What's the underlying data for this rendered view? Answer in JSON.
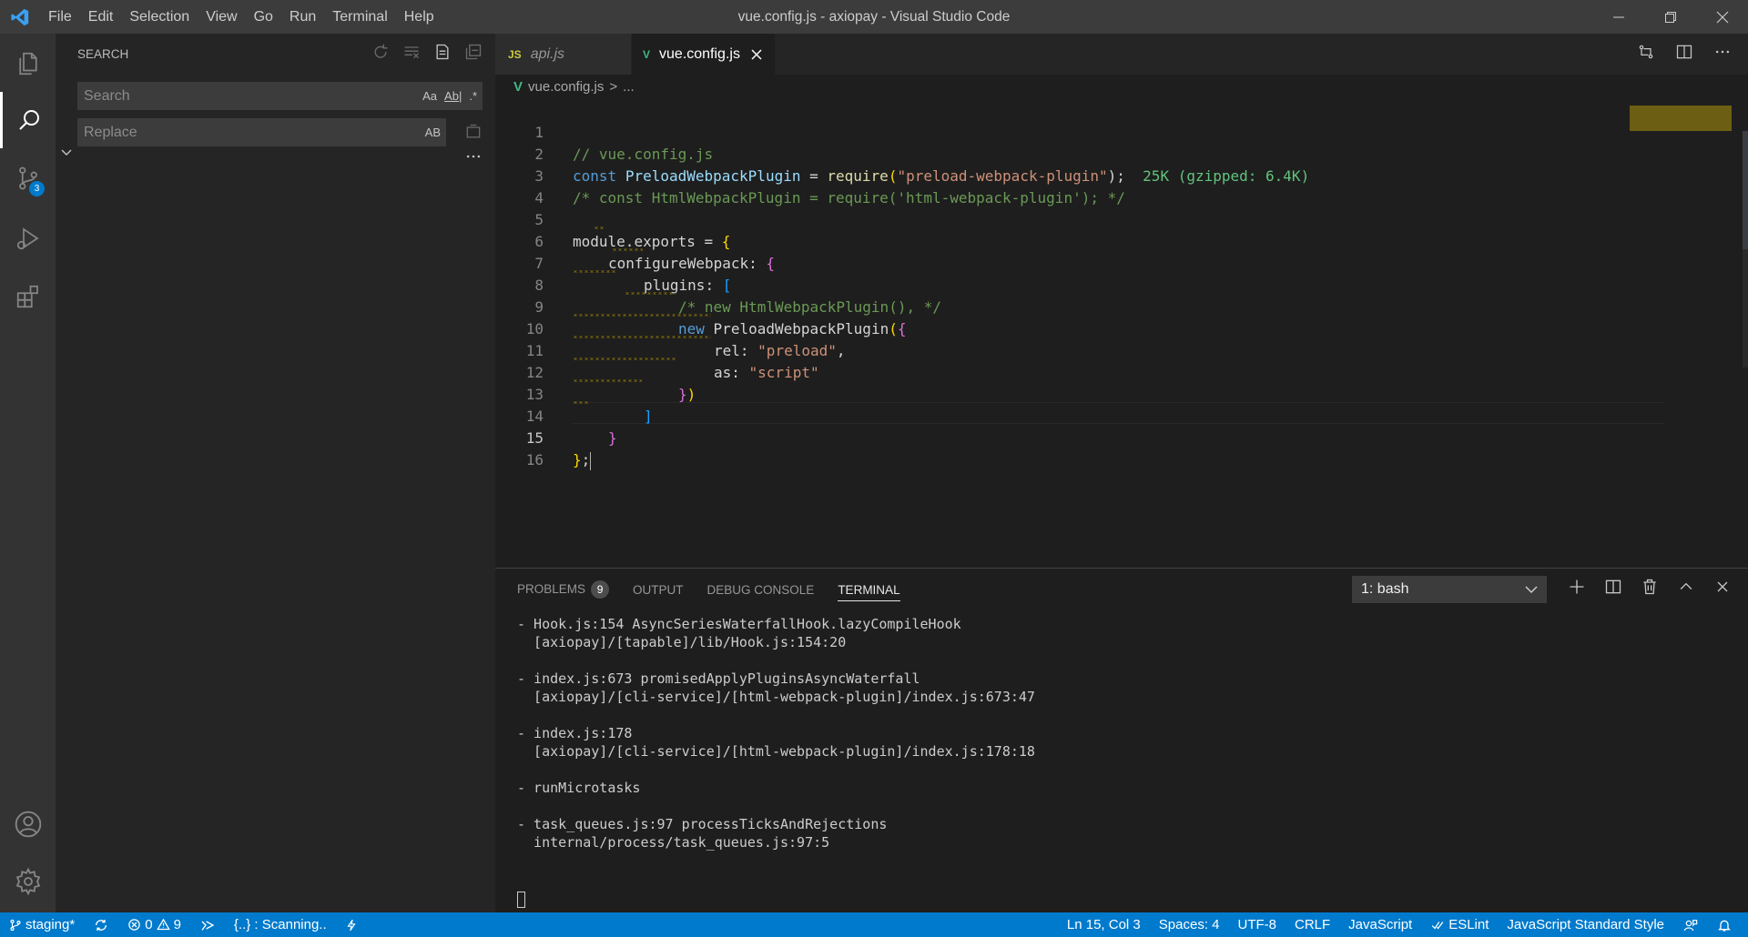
{
  "window": {
    "title": "vue.config.js - axiopay - Visual Studio Code",
    "menu": [
      "File",
      "Edit",
      "Selection",
      "View",
      "Go",
      "Run",
      "Terminal",
      "Help"
    ]
  },
  "activity": {
    "scm_badge": "3"
  },
  "sidebar": {
    "title": "SEARCH",
    "search_placeholder": "Search",
    "replace_placeholder": "Replace",
    "opt_case": "Aa",
    "opt_word": "Ab|",
    "opt_regex": ".*",
    "opt_preserve": "AB"
  },
  "tabs": [
    {
      "icon": "JS",
      "label": "api.js"
    },
    {
      "icon": "V",
      "label": "vue.config.js"
    }
  ],
  "breadcrumb": {
    "file": "vue.config.js",
    "sep": ">",
    "rest": "..."
  },
  "editor": {
    "line_numbers": [
      "1",
      "2",
      "3",
      "4",
      "5",
      "6",
      "7",
      "8",
      "9",
      "10",
      "11",
      "12",
      "13",
      "14",
      "15",
      "16"
    ],
    "lines": {
      "l1": "// vue.config.js",
      "l2_kw": "const",
      "l2_var": "PreloadWebpackPlugin",
      "l2_eq": " = ",
      "l2_fn": "require",
      "l2_open": "(",
      "l2_str": "\"preload-webpack-plugin\"",
      "l2_close": ");",
      "l2_hint": "25K (gzipped: 6.4K)",
      "l3": "/* const HtmlWebpackPlugin = require('html-webpack-plugin'); */",
      "l5_a": "module",
      "l5_b": ".",
      "l5_c": "exports",
      "l5_d": " = ",
      "l5_e": "{",
      "l6_a": "configureWebpack",
      "l6_b": ": ",
      "l6_c": "{",
      "l7_a": "plugins",
      "l7_b": ": ",
      "l7_c": "[",
      "l8": "/* new HtmlWebpackPlugin(), */",
      "l9_a": "new",
      "l9_b": "PreloadWebpackPlugin",
      "l9_c": "(",
      "l9_d": "{",
      "l10_a": "rel",
      "l10_b": ": ",
      "l10_c": "\"preload\"",
      "l10_d": ",",
      "l11_a": "as",
      "l11_b": ": ",
      "l11_c": "\"script\"",
      "l12_a": "}",
      "l12_b": ")",
      "l13": "]",
      "l14": "}",
      "l15_a": "}",
      "l15_b": ";"
    }
  },
  "panel": {
    "tabs": [
      "PROBLEMS",
      "OUTPUT",
      "DEBUG CONSOLE",
      "TERMINAL"
    ],
    "problems_count": "9",
    "terminal_select": "1: bash",
    "terminal_output": "- Hook.js:154 AsyncSeriesWaterfallHook.lazyCompileHook\n  [axiopay]/[tapable]/lib/Hook.js:154:20\n\n- index.js:673 promisedApplyPluginsAsyncWaterfall\n  [axiopay]/[cli-service]/[html-webpack-plugin]/index.js:673:47\n\n- index.js:178\n  [axiopay]/[cli-service]/[html-webpack-plugin]/index.js:178:18\n\n- runMicrotasks\n\n- task_queues.js:97 processTicksAndRejections\n  internal/process/task_queues.js:97:5"
  },
  "statusbar": {
    "branch": "staging*",
    "errors": "0",
    "warnings": "9",
    "scanning": "{..} : Scanning..",
    "position": "Ln 15, Col 3",
    "spaces": "Spaces: 4",
    "encoding": "UTF-8",
    "eol": "CRLF",
    "language": "JavaScript",
    "eslint": "ESLint",
    "style": "JavaScript Standard Style"
  },
  "colors": {
    "statusbar": "#007acc",
    "titlebar": "#3c3c3c",
    "activitybar": "#333333",
    "sidebar": "#252526",
    "editor": "#1e1e1e"
  }
}
